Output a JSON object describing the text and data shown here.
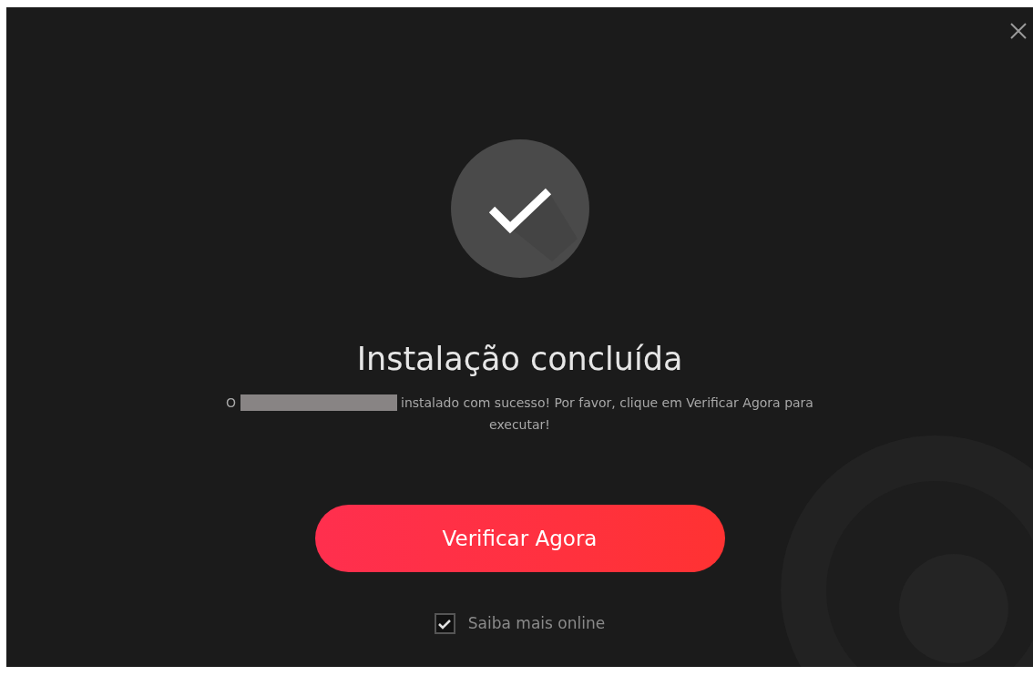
{
  "title": "Instalação concluída",
  "message": {
    "prefix": "O",
    "redacted": true,
    "suffix": "instalado com sucesso! Por favor, clique em Verificar Agora para executar!"
  },
  "primary_button": "Verificar Agora",
  "learn_more": {
    "label": "Saiba mais online",
    "checked": true
  }
}
